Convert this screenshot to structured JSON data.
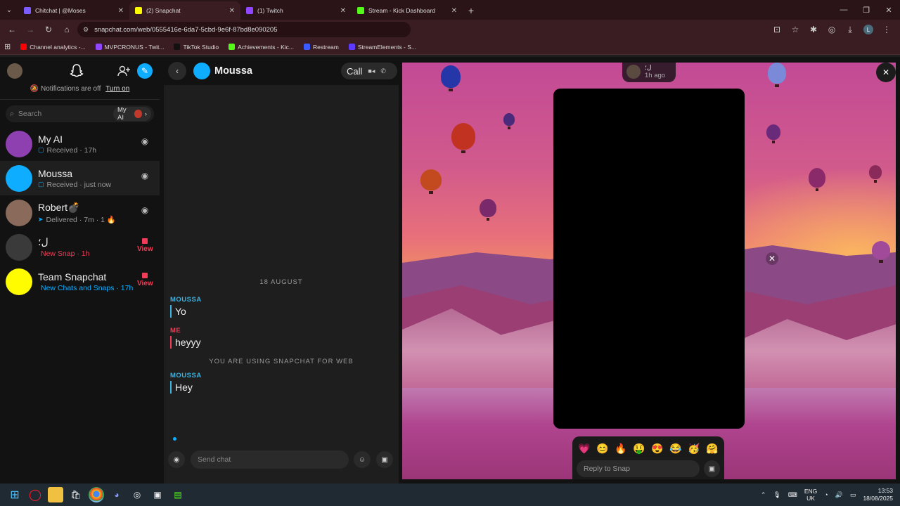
{
  "browser": {
    "tabs": [
      {
        "title": "Chitchat | @Moses",
        "color": "#7b5cff",
        "active": false
      },
      {
        "title": "(2) Snapchat",
        "color": "#fffc00",
        "active": true
      },
      {
        "title": "(1) Twitch",
        "color": "#9146ff",
        "active": false
      },
      {
        "title": "Stream - Kick Dashboard",
        "color": "#53fc18",
        "active": false
      }
    ],
    "url": "snapchat.com/web/0555416e-6da7-5cbd-9e6f-87bd8e090205",
    "profile_initial": "L",
    "bookmarks": [
      {
        "label": "Channel analytics -...",
        "color": "#ff0000"
      },
      {
        "label": "MVPCRONUS - Twit...",
        "color": "#9146ff"
      },
      {
        "label": "TikTok Studio",
        "color": "#111111"
      },
      {
        "label": "Achievements - Kic...",
        "color": "#53fc18"
      },
      {
        "label": "Restream",
        "color": "#3b5bff"
      },
      {
        "label": "StreamElements - S...",
        "color": "#5c3bff"
      }
    ]
  },
  "sidebar": {
    "notifications_text": "Notifications are off",
    "turn_on": "Turn on",
    "search_placeholder": "Search",
    "myai_chip": "My AI",
    "conversations": [
      {
        "name": "My AI",
        "status": "Received · 17h",
        "status_color": "#999999",
        "icon": "▢",
        "icon_color": "#0fadff",
        "avatar": "#8e3fb0",
        "right": "camera"
      },
      {
        "name": "Moussa",
        "status": "Received · just now",
        "status_color": "#999999",
        "icon": "▢",
        "icon_color": "#0fadff",
        "avatar": "#0fadff",
        "right": "camera"
      },
      {
        "name": "Robert💣",
        "status": "Delivered · 7m · 1 🔥",
        "status_color": "#999999",
        "icon": "➤",
        "icon_color": "#0fadff",
        "avatar": "#8a6a5a",
        "right": "camera"
      },
      {
        "name": "ل؛",
        "status": "New Snap · 1h",
        "status_color": "#f23c57",
        "icon": "",
        "icon_color": "#f23c57",
        "avatar": "#3a3a3a",
        "right": "view"
      },
      {
        "name": "Team Snapchat",
        "status": "New Chats and Snaps · 17h",
        "status_color": "#0fadff",
        "icon": "",
        "icon_color": "#0fadff",
        "avatar": "#fffc00",
        "right": "view"
      }
    ],
    "view_label": "View"
  },
  "chat": {
    "contact_name": "Moussa",
    "call_label": "Call",
    "date_separator": "18 AUGUST",
    "messages": [
      {
        "sender": "MOUSSA",
        "text": "Yo",
        "color": "#3cb2e2"
      },
      {
        "sender": "ME",
        "text": "heyyy",
        "color": "#f23c57"
      },
      {
        "sender": "MOUSSA",
        "text": "Hey",
        "color": "#3cb2e2"
      }
    ],
    "system_note": "YOU ARE USING SNAPCHAT FOR WEB",
    "input_placeholder": "Send chat"
  },
  "snap_viewer": {
    "sender_name": "ل؛",
    "sender_time": "1h ago",
    "reply_placeholder": "Reply to Snap",
    "reactions": [
      "💗",
      "😊",
      "🔥",
      "🤑",
      "😍",
      "😂",
      "🥳",
      "🤗"
    ]
  },
  "taskbar": {
    "language": "ENG",
    "region": "UK",
    "time": "13:53",
    "date": "18/08/2025"
  }
}
